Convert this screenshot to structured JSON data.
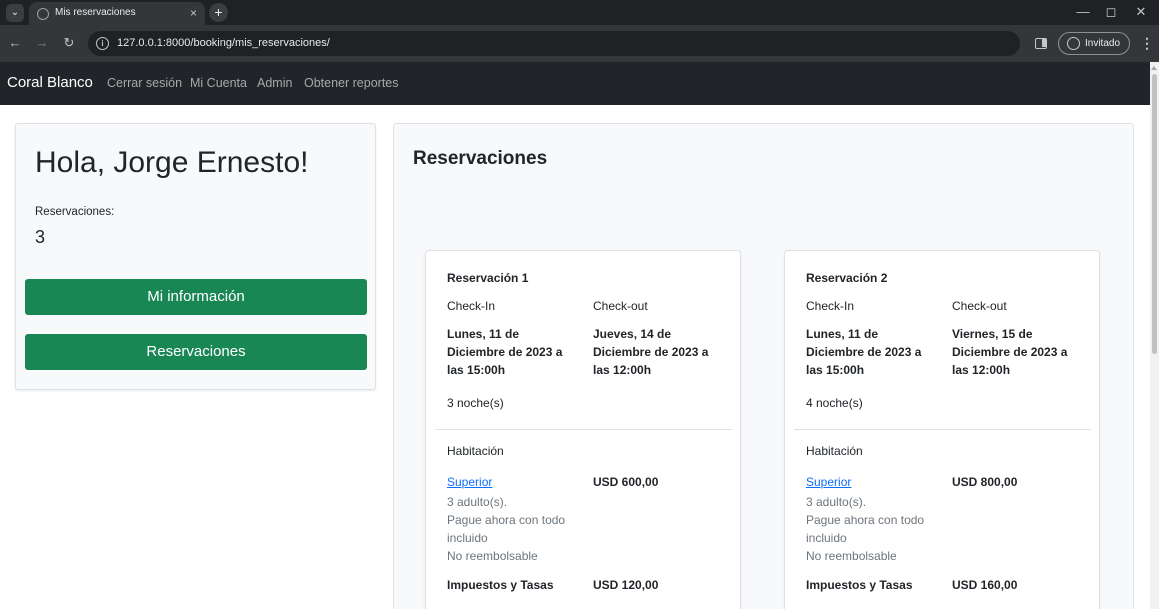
{
  "browser": {
    "tab_title": "Mis reservaciones",
    "tab_close": "×",
    "new_tab": "+",
    "url": "127.0.0.1:8000/booking/mis_reservaciones/",
    "profile_label": "Invitado"
  },
  "navbar": {
    "brand": "Coral Blanco",
    "links": [
      "Cerrar sesión",
      "Mi Cuenta",
      "Admin",
      "Obtener reportes"
    ]
  },
  "sidebar": {
    "greeting": "Hola, Jorge Ernesto!",
    "reservations_label": "Reservaciones:",
    "reservations_count": "3",
    "buttons": [
      "Mi información",
      "Reservaciones"
    ],
    "button_color": "#198754"
  },
  "main": {
    "title": "Reservaciones",
    "reservations": [
      {
        "title": "Reservación 1",
        "checkin_label": "Check-In",
        "checkout_label": "Check-out",
        "checkin": "Lunes, 11 de Diciembre de 2023 a las 15:00h",
        "checkout": "Jueves, 14 de Diciembre de 2023 a las 12:00h",
        "nights": "3 noche(s)",
        "room_label": "Habitación",
        "room_name": "Superior",
        "room_details": [
          "3 adulto(s).",
          "Pague ahora con todo incluido",
          "No reembolsable"
        ],
        "room_price": "USD 600,00",
        "tax_label": "Impuestos y Tasas",
        "tax": "USD 120,00"
      },
      {
        "title": "Reservación 2",
        "checkin_label": "Check-In",
        "checkout_label": "Check-out",
        "checkin": "Lunes, 11 de Diciembre de 2023 a las 15:00h",
        "checkout": "Viernes, 15 de Diciembre de 2023 a las 12:00h",
        "nights": "4 noche(s)",
        "room_label": "Habitación",
        "room_name": "Superior",
        "room_details": [
          "3 adulto(s).",
          "Pague ahora con todo incluido",
          "No reembolsable"
        ],
        "room_price": "USD 800,00",
        "tax_label": "Impuestos y Tasas",
        "tax": "USD 160,00"
      }
    ]
  }
}
